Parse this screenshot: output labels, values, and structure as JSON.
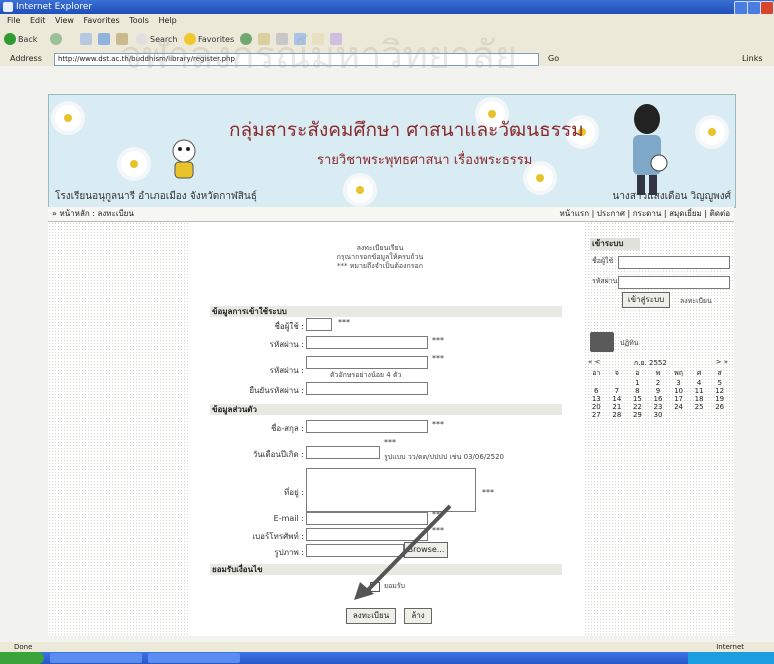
{
  "window": {
    "title": "Internet Explorer",
    "menu": [
      "File",
      "Edit",
      "View",
      "Favorites",
      "Tools",
      "Help"
    ],
    "toolbar": {
      "back": "Back",
      "search": "Search",
      "favorites": "Favorites"
    },
    "address_label": "Address",
    "address_url": "http://www.dst.ac.th/buddhism/library/register.php",
    "go": "Go",
    "links": "Links"
  },
  "banner": {
    "title": "กลุ่มสาระสังคมศึกษา ศาสนาและวัฒนธรรม",
    "subtitle": "รายวิชาพระพุทธศาสนา เรื่องพระธรรม",
    "school": "โรงเรียนอนุกูลนารี อำเภอเมือง จังหวัดกาฬสินธุ์",
    "teacher": "นางสาวแสงเดือน วิญญูพงศ์"
  },
  "navbar": {
    "breadcrumb": "» หน้าหลัก : ลงทะเบียน",
    "links": "หน้าแรก | ประกาศ | กระดาน | สมุดเยี่ยม | ติดต่อ"
  },
  "notice": {
    "line1": "ลงทะเบียนเรียน",
    "line2": "กรุณากรอกข้อมูลให้ครบถ้วน",
    "line3": "*** หมายถึงจำเป็นต้องกรอก"
  },
  "form": {
    "section_account": "ข้อมูลการเข้าใช้ระบบ",
    "username": "ชื่อผู้ใช้ :",
    "password": "รหัสผ่าน :",
    "password_hint": "ตัวอักษรอย่างน้อย 4 ตัว",
    "confirm": "ยืนยันรหัสผ่าน :",
    "section_personal": "ข้อมูลส่วนตัว",
    "fullname": "ชื่อ-สกุล :",
    "birthdate": "วันเดือนปีเกิด :",
    "birthdate_hint": "รูปแบบ วว/ดด/ปปปป เช่น 03/06/2520",
    "address": "ที่อยู่ :",
    "email": "E-mail :",
    "phone": "เบอร์โทรศัพท์ :",
    "photo": "รูปภาพ :",
    "browse": "Browse...",
    "section_agree": "ยอมรับเงื่อนไข",
    "agree_checkbox": "ยอมรับ",
    "submit": "ลงทะเบียน",
    "reset": "ล้าง",
    "required": "***"
  },
  "login": {
    "title": "เข้าระบบ",
    "username": "ชื่อผู้ใช้",
    "password": "รหัสผ่าน",
    "login_button": "เข้าสู่ระบบ",
    "register_link": "ลงทะเบียน"
  },
  "calendar": {
    "title": "ปฏิทิน",
    "month": "ก.ย. 2552",
    "prev": "« <",
    "next": "> »",
    "weekdays": [
      "อา",
      "จ",
      "อ",
      "พ",
      "พฤ",
      "ศ",
      "ส"
    ],
    "weeks": [
      [
        "",
        "",
        "1",
        "2",
        "3",
        "4",
        "5"
      ],
      [
        "6",
        "7",
        "8",
        "9",
        "10",
        "11",
        "12"
      ],
      [
        "13",
        "14",
        "15",
        "16",
        "17",
        "18",
        "19"
      ],
      [
        "20",
        "21",
        "22",
        "23",
        "24",
        "25",
        "26"
      ],
      [
        "27",
        "28",
        "29",
        "30",
        "",
        "",
        ""
      ]
    ]
  },
  "status": {
    "left": "Done",
    "right": "Internet"
  },
  "watermark": "จุฬาลงกรณ์มหาวิทยาลัย",
  "colors": {
    "banner_text": "#8a2a2a",
    "banner_bg": "#d9ecf3",
    "titlebar": "#1f4fb8"
  }
}
